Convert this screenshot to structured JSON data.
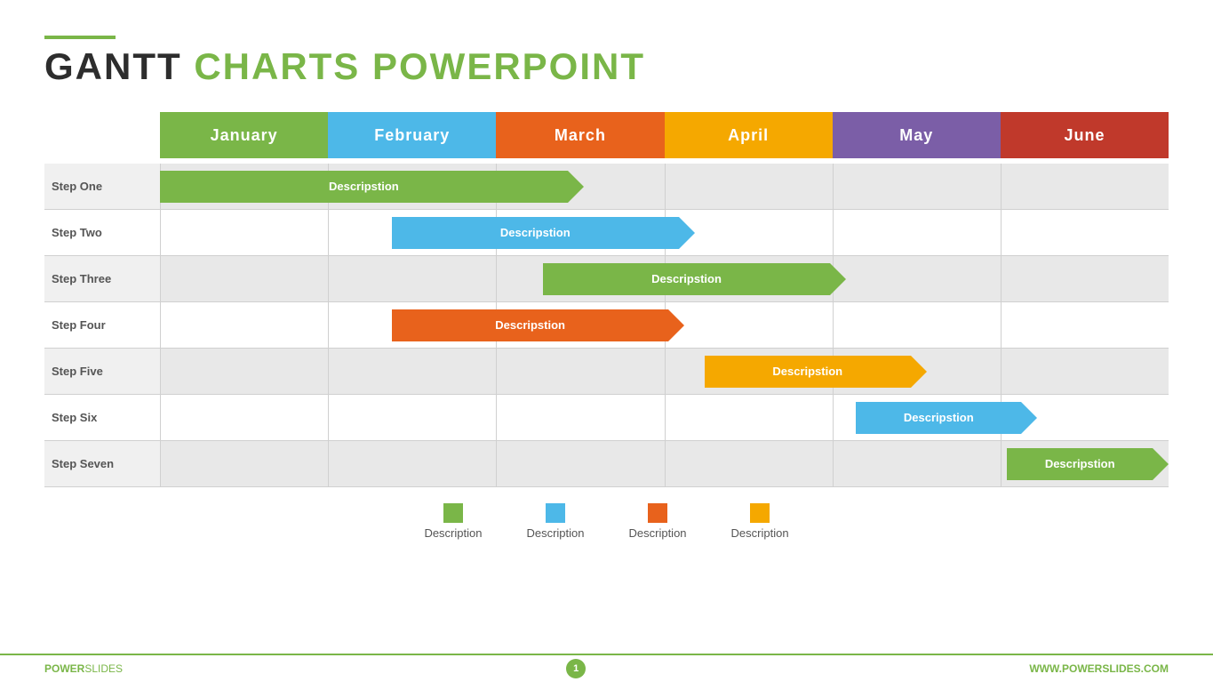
{
  "header": {
    "line_color": "#7ab648",
    "title_black": "GANTT",
    "title_green": "CHARTS POWERPOINT"
  },
  "months": [
    {
      "label": "January",
      "color": "#7ab648"
    },
    {
      "label": "February",
      "color": "#4db8e8"
    },
    {
      "label": "March",
      "color": "#e8621c"
    },
    {
      "label": "April",
      "color": "#f5a800"
    },
    {
      "label": "May",
      "color": "#7b5ea7"
    },
    {
      "label": "June",
      "color": "#c0392b"
    }
  ],
  "rows": [
    {
      "label": "Step One",
      "shaded": true,
      "bar": {
        "text": "Descripstion",
        "color": "#7ab648",
        "left_pct": 0,
        "width_pct": 42
      }
    },
    {
      "label": "Step Two",
      "shaded": false,
      "bar": {
        "text": "Descripstion",
        "color": "#4db8e8",
        "left_pct": 23,
        "width_pct": 30
      }
    },
    {
      "label": "Step Three",
      "shaded": true,
      "bar": {
        "text": "Descripstion",
        "color": "#7ab648",
        "left_pct": 38,
        "width_pct": 30
      }
    },
    {
      "label": "Step Four",
      "shaded": false,
      "bar": {
        "text": "Descripstion",
        "color": "#e8621c",
        "left_pct": 23,
        "width_pct": 29
      }
    },
    {
      "label": "Step Five",
      "shaded": true,
      "bar": {
        "text": "Descripstion",
        "color": "#f5a800",
        "left_pct": 54,
        "width_pct": 22
      }
    },
    {
      "label": "Step Six",
      "shaded": false,
      "bar": {
        "text": "Descripstion",
        "color": "#4db8e8",
        "left_pct": 69,
        "width_pct": 18
      }
    },
    {
      "label": "Step Seven",
      "shaded": true,
      "bar": {
        "text": "Descripstion",
        "color": "#7ab648",
        "left_pct": 84,
        "width_pct": 16
      }
    }
  ],
  "legend": [
    {
      "color": "#7ab648",
      "label": "Description"
    },
    {
      "color": "#4db8e8",
      "label": "Description"
    },
    {
      "color": "#e8621c",
      "label": "Description"
    },
    {
      "color": "#f5a800",
      "label": "Description"
    }
  ],
  "footer": {
    "left_bold": "POWER",
    "left_normal": "SLIDES",
    "page_number": "1",
    "right": "WWW.POWERSLIDES.COM"
  }
}
